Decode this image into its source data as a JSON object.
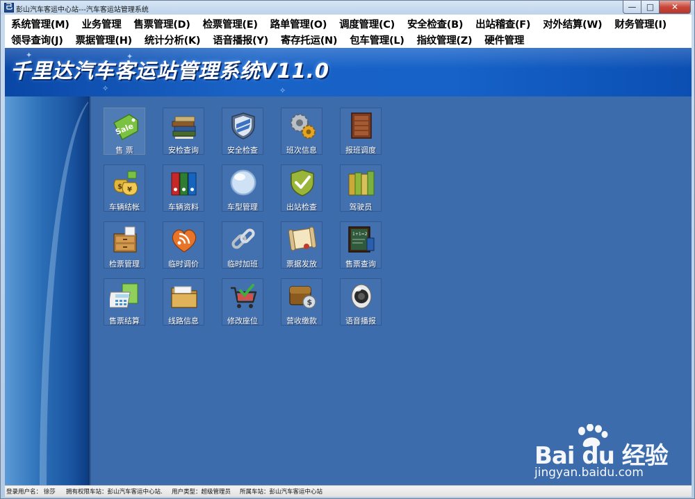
{
  "window": {
    "title": "彭山汽车客运中心站---汽车客运站管理系统",
    "controls": {
      "minimize": "—",
      "maximize": "□",
      "close": "✕"
    }
  },
  "menu": {
    "row1": [
      "系统管理(M)",
      "业务管理",
      "售票管理(D)",
      "检票管理(E)",
      "路单管理(O)",
      "调度管理(C)",
      "安全检查(B)",
      "出站稽查(F)",
      "对外结算(W)",
      "财务管理(I)"
    ],
    "row2": [
      "领导查询(J)",
      "票据管理(H)",
      "统计分析(K)",
      "语音播报(Y)",
      "寄存托运(N)",
      "包车管理(L)",
      "指纹管理(Z)",
      "硬件管理"
    ]
  },
  "banner": {
    "title": "千里达汽车客运站管理系统V11.0"
  },
  "tiles": [
    {
      "label": "售 票",
      "icon": "sale-tag-icon"
    },
    {
      "label": "安检查询",
      "icon": "book-stack-icon"
    },
    {
      "label": "安全检查",
      "icon": "shield-icon"
    },
    {
      "label": "班次信息",
      "icon": "gears-icon"
    },
    {
      "label": "报班调度",
      "icon": "door-icon"
    },
    {
      "label": "车辆结帐",
      "icon": "money-bags-icon"
    },
    {
      "label": "车辆资料",
      "icon": "binders-icon"
    },
    {
      "label": "车型管理",
      "icon": "glass-sphere-icon"
    },
    {
      "label": "出站检查",
      "icon": "check-shield-icon"
    },
    {
      "label": "驾驶员",
      "icon": "folders-icon"
    },
    {
      "label": "检票管理",
      "icon": "file-drawer-icon"
    },
    {
      "label": "临时调价",
      "icon": "rss-heart-icon"
    },
    {
      "label": "临时加班",
      "icon": "chain-link-icon"
    },
    {
      "label": "票据发放",
      "icon": "scroll-icon"
    },
    {
      "label": "售票查询",
      "icon": "chalkboard-icon"
    },
    {
      "label": "售票结算",
      "icon": "calculator-icon"
    },
    {
      "label": "线路信息",
      "icon": "folder-icon"
    },
    {
      "label": "修改座位",
      "icon": "shopping-cart-icon"
    },
    {
      "label": "营收缴款",
      "icon": "wallet-coin-icon"
    },
    {
      "label": "语音播报",
      "icon": "speaker-icon"
    }
  ],
  "status": {
    "login_user": "登录用户名： 徐莎",
    "authorized_station": "拥有权限车站：彭山汽车客运中心站.",
    "user_type": "用户类型：超级管理员",
    "station": "所属车站：彭山汽车客运中心站"
  },
  "watermark": {
    "logo": "Bai du 经验",
    "url": "jingyan.baidu.com"
  },
  "colors": {
    "main_bg": "#3c6cac",
    "banner": "#1662c8",
    "menu_bg": "#ffffff",
    "title_bar": "#c9dbef"
  }
}
